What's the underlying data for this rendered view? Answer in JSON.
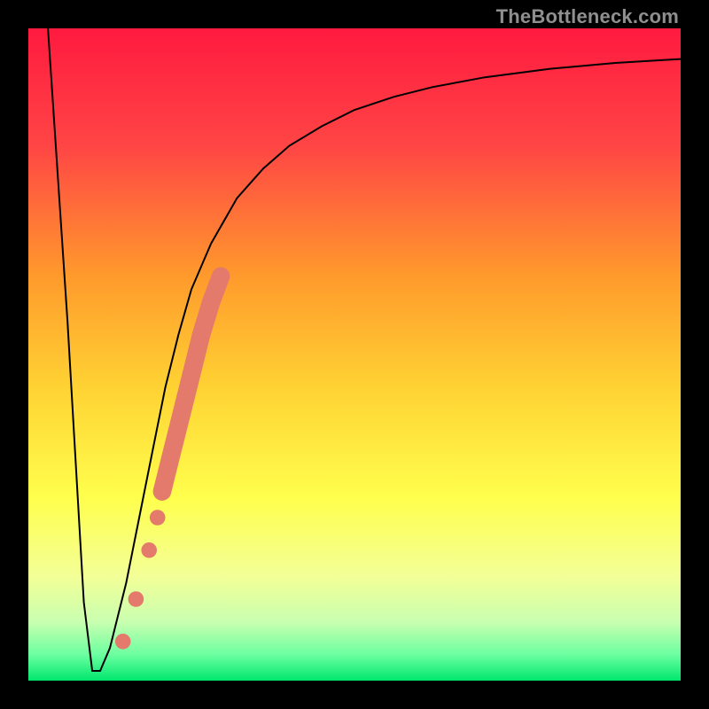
{
  "watermark": "TheBottleneck.com",
  "chart_data": {
    "type": "line",
    "title": "",
    "xlabel": "",
    "ylabel": "",
    "xlim": [
      0,
      100
    ],
    "ylim": [
      0,
      100
    ],
    "series": [
      {
        "name": "bottleneck-curve",
        "x": [
          3,
          6,
          8.5,
          9.8,
          11,
          12.5,
          15,
          17,
          19,
          21,
          23,
          25,
          28,
          32,
          36,
          40,
          45,
          50,
          56,
          62,
          70,
          80,
          90,
          100
        ],
        "y": [
          100,
          55,
          12,
          1.5,
          1.5,
          5,
          15,
          25,
          35,
          45,
          53,
          60,
          67,
          74,
          78.5,
          82,
          85,
          87.5,
          89.5,
          91,
          92.5,
          93.8,
          94.7,
          95.3
        ]
      }
    ],
    "markers": [
      {
        "name": "dot-1",
        "x": 14.5,
        "y": 6.0,
        "r": 1.2
      },
      {
        "name": "dot-2",
        "x": 16.5,
        "y": 12.5,
        "r": 1.2
      },
      {
        "name": "dot-3",
        "x": 18.5,
        "y": 20.0,
        "r": 1.2
      },
      {
        "name": "dot-4",
        "x": 19.8,
        "y": 25.0,
        "r": 1.2
      }
    ],
    "thick_segment": {
      "name": "highlight-band",
      "x": [
        20.5,
        22.0,
        23.5,
        25.0,
        26.5,
        28.0,
        29.5
      ],
      "y": [
        29.0,
        35.0,
        41.0,
        47.0,
        53.0,
        58.0,
        62.0
      ],
      "width": 2.8
    },
    "background": {
      "type": "vertical-gradient",
      "stops": [
        {
          "pos": 0.0,
          "color": "#ff1a3f"
        },
        {
          "pos": 0.18,
          "color": "#ff4545"
        },
        {
          "pos": 0.38,
          "color": "#ff9a2c"
        },
        {
          "pos": 0.55,
          "color": "#ffd233"
        },
        {
          "pos": 0.72,
          "color": "#ffff4d"
        },
        {
          "pos": 0.84,
          "color": "#f3ff97"
        },
        {
          "pos": 0.91,
          "color": "#c9ffb0"
        },
        {
          "pos": 0.96,
          "color": "#6cffa0"
        },
        {
          "pos": 1.0,
          "color": "#00e76e"
        }
      ]
    },
    "colors": {
      "curve": "#000000",
      "marker": "#e47a6b",
      "background_black": "#000000"
    }
  }
}
